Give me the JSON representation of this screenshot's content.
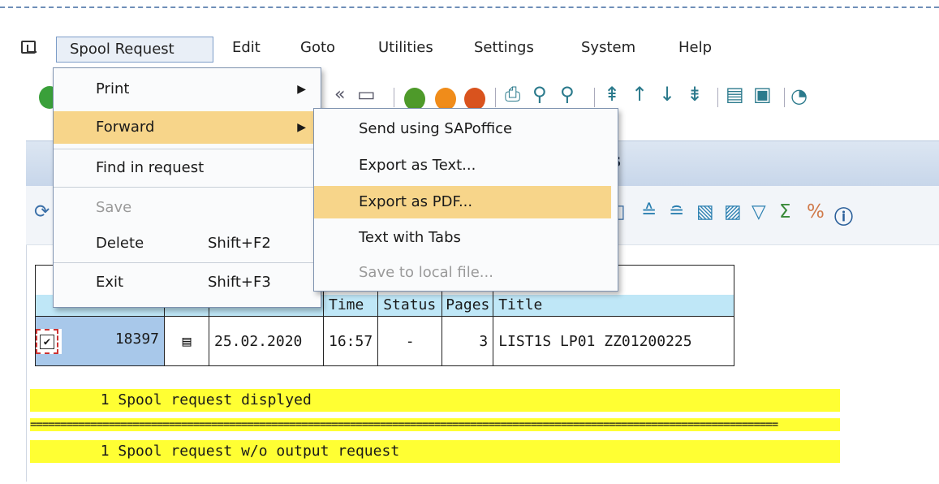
{
  "menubar": {
    "items": [
      "Spool Request",
      "Edit",
      "Goto",
      "Utilities",
      "Settings",
      "System",
      "Help"
    ]
  },
  "spool_menu": {
    "items": [
      {
        "label": "Print",
        "submenu": true
      },
      {
        "label": "Forward",
        "submenu": true,
        "highlighted": true
      },
      {
        "label": "Find in request"
      },
      {
        "label": "Save",
        "disabled": true
      },
      {
        "label": "Delete",
        "shortcut": "Shift+F2"
      },
      {
        "label": "Exit",
        "shortcut": "Shift+F3"
      }
    ]
  },
  "forward_menu": {
    "items": [
      {
        "label": "Send using SAPoffice"
      },
      {
        "label": "Export as Text..."
      },
      {
        "label": "Export as PDF...",
        "highlighted": true
      },
      {
        "label": "Text with Tabs"
      },
      {
        "label": "Save to local file...",
        "disabled": true
      }
    ]
  },
  "panel": {
    "title_partial": "s"
  },
  "table": {
    "headers": [
      "",
      "",
      "",
      "Time",
      "Status",
      "Pages",
      "Title"
    ],
    "rows": [
      {
        "checked": true,
        "spool_no": "18397",
        "date": "25.02.2020",
        "time": "16:57",
        "status": "-",
        "pages": "3",
        "title": "LIST1S LP01 ZZ01200225"
      }
    ]
  },
  "messages": {
    "line1": "        1 Spool request displyed",
    "separator": "============================================================================================================================",
    "line2": "        1 Spool request w/o output request"
  },
  "colors": {
    "highlight": "#f7d58a",
    "header_fill": "#bfe7f7",
    "message_bg": "#ffff33",
    "selection": "#a8c8ea"
  }
}
